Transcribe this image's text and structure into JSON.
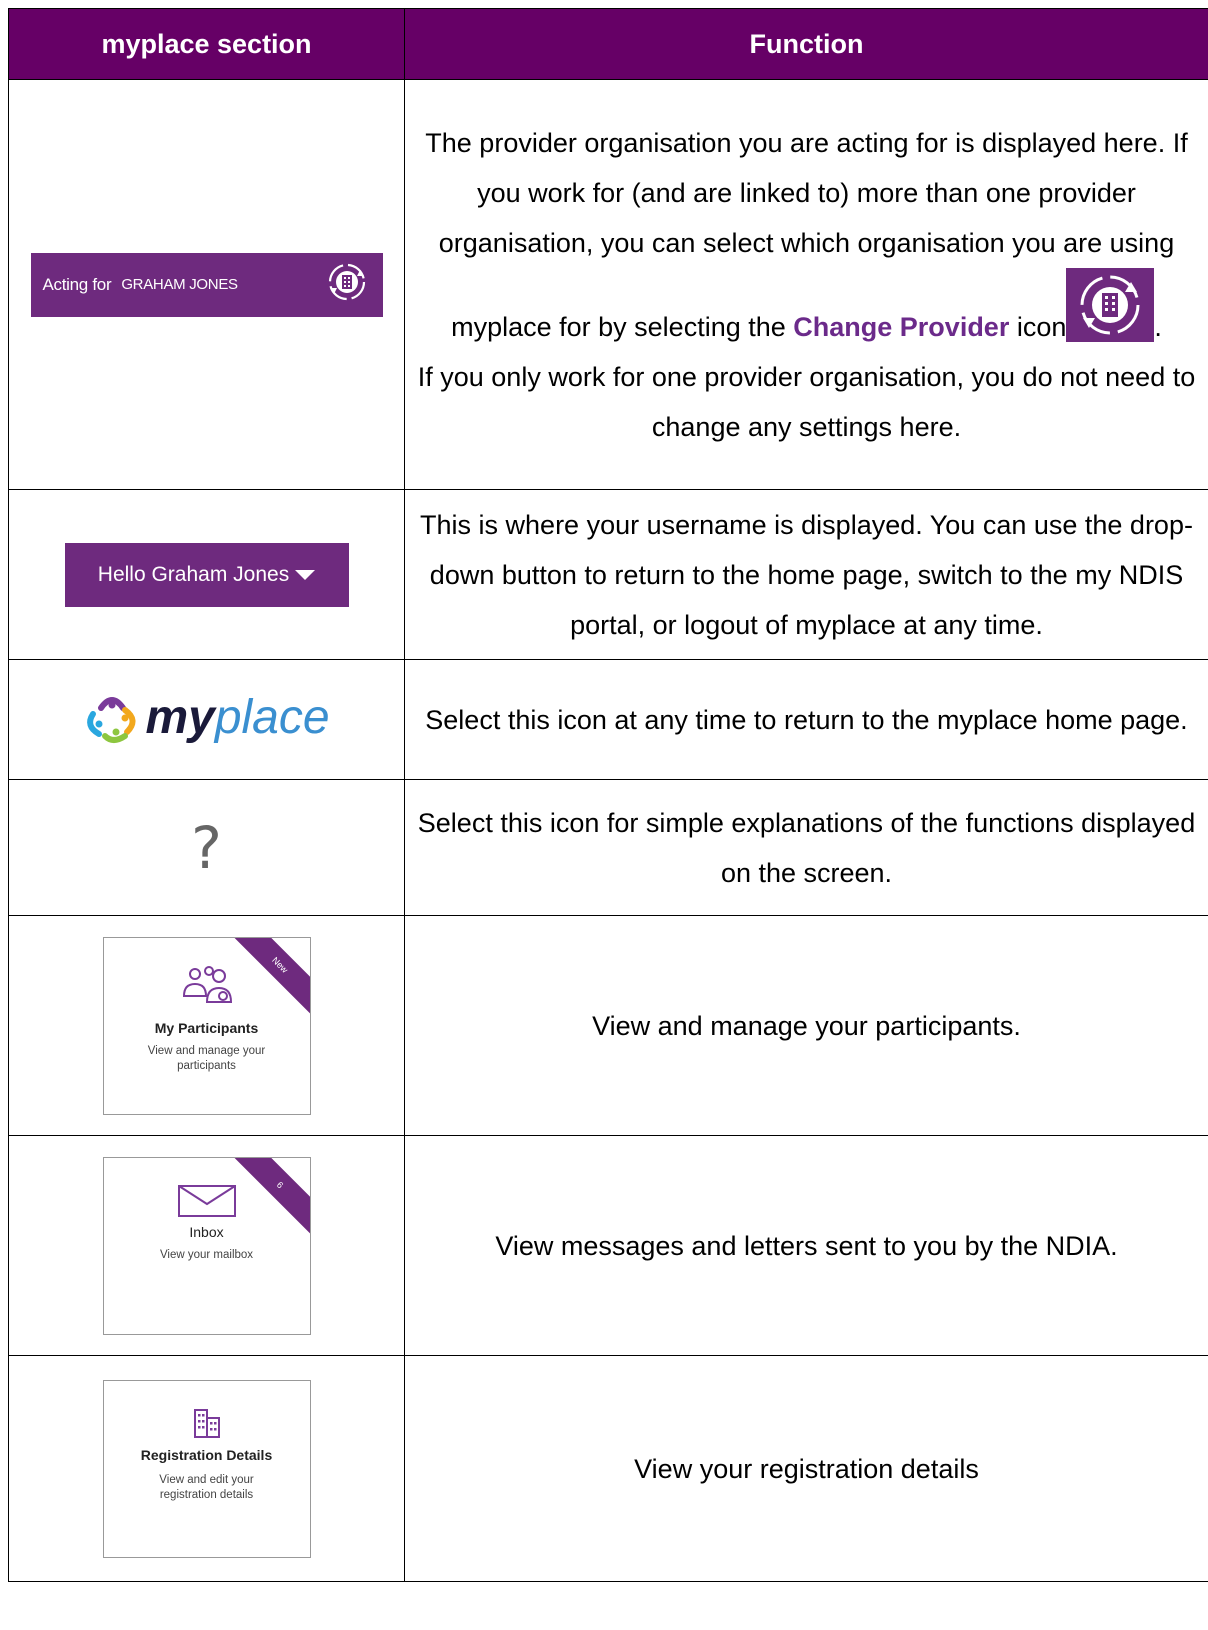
{
  "header": {
    "col1": "myplace section",
    "col2": "Function"
  },
  "rows": {
    "acting": {
      "label": "Acting for",
      "name": "GRAHAM JONES",
      "text1": "The provider organisation you are acting for is displayed here. If you work for (and are linked to) more than one provider organisation, you can select which organisation you are using myplace for by selecting the",
      "bold1": "Change Provider",
      "text2": "icon",
      "text3": ".",
      "text4": "If you only work for one provider organisation, you do not need to change any settings here."
    },
    "hello": {
      "label": "Hello Graham Jones",
      "text": "This is where your username is displayed. You can use the drop-down button to return to the home page, switch to the my NDIS portal, or logout of myplace at any time."
    },
    "logo": {
      "my": "my",
      "place": "place",
      "text": "Select this icon at any time to return to the myplace home page."
    },
    "help": {
      "symbol": "?",
      "text": "Select this icon for simple explanations of the functions displayed on the screen."
    },
    "participants": {
      "title": "My Participants",
      "desc": "View and manage your participants",
      "badge": "New",
      "text": "View and manage your participants."
    },
    "inbox": {
      "title": "Inbox",
      "desc": "View your mailbox",
      "badge": "6",
      "text": "View messages and letters sent to you by the NDIA."
    },
    "registration": {
      "title": "Registration Details",
      "desc": "View and edit your registration details",
      "text": "View your registration details"
    }
  },
  "colors": {
    "header_bg": "#660066",
    "brand_purple": "#6e2a7e",
    "link_purple": "#6b2a8a"
  }
}
